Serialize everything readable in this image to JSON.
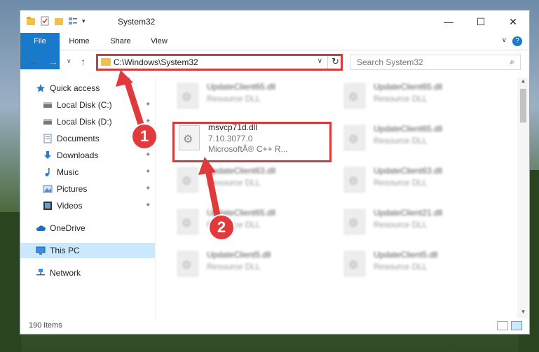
{
  "window": {
    "title": "System32",
    "controls": {
      "minimize": "—",
      "maximize": "☐",
      "close": "✕"
    }
  },
  "ribbon": {
    "tabs": [
      "File",
      "Home",
      "Share",
      "View"
    ],
    "collapse": "∨",
    "help": "?"
  },
  "nav": {
    "back": "←",
    "forward": "→",
    "recent": "∨",
    "up": "↑",
    "address": "C:\\Windows\\System32",
    "address_dropdown": "∨",
    "refresh": "↻",
    "search_placeholder": "Search System32",
    "search_icon": "⌕"
  },
  "sidebar": {
    "items": [
      {
        "label": "Quick access",
        "icon": "star-icon",
        "pinned": false
      },
      {
        "label": "Local Disk (C:)",
        "icon": "drive-icon",
        "pinned": true
      },
      {
        "label": "Local Disk (D:)",
        "icon": "drive-icon",
        "pinned": true
      },
      {
        "label": "Documents",
        "icon": "documents-icon",
        "pinned": true
      },
      {
        "label": "Downloads",
        "icon": "download-icon",
        "pinned": true
      },
      {
        "label": "Music",
        "icon": "music-icon",
        "pinned": true
      },
      {
        "label": "Pictures",
        "icon": "pictures-icon",
        "pinned": true
      },
      {
        "label": "Videos",
        "icon": "videos-icon",
        "pinned": true
      },
      {
        "label": "OneDrive",
        "icon": "cloud-icon",
        "pinned": false
      },
      {
        "label": "This PC",
        "icon": "computer-icon",
        "pinned": false,
        "selected": true
      },
      {
        "label": "Network",
        "icon": "network-icon",
        "pinned": false
      }
    ],
    "pin_glyph": "📌"
  },
  "files": [
    {
      "name": "UpdateClient65.dll",
      "type": "Resource DLL",
      "blurred": true
    },
    {
      "name": "UpdateClient65.dll",
      "type": "Resource DLL",
      "blurred": true
    },
    {
      "name": "msvcp71d.dll",
      "version": "7.10.3077.0",
      "company": "MicrosoftÂ® C++ R...",
      "blurred": false
    },
    {
      "name": "UpdateClient65.dll",
      "type": "Resource DLL",
      "blurred": true
    },
    {
      "name": "UpdateClient63.dll",
      "type": "Resource DLL",
      "blurred": true
    },
    {
      "name": "UpdateClient63.dll",
      "type": "Resource DLL",
      "blurred": true
    },
    {
      "name": "UpdateClient65.dll",
      "type": "Resource DLL",
      "blurred": true
    },
    {
      "name": "UpdateClient21.dll",
      "type": "Resource DLL",
      "blurred": true
    },
    {
      "name": "UpdateClient5.dll",
      "type": "Resource DLL",
      "blurred": true
    },
    {
      "name": "UpdateClient5.dll",
      "type": "Resource DLL",
      "blurred": true
    }
  ],
  "status": {
    "item_count": "190 items"
  },
  "callouts": [
    "1",
    "2"
  ],
  "colors": {
    "accent": "#1979ca",
    "highlight": "#d9393b",
    "selection": "#cce8ff"
  }
}
